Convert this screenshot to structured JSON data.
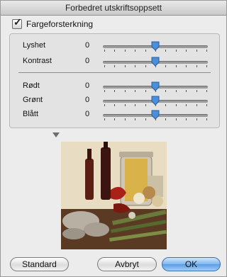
{
  "window": {
    "title": "Forbedret utskriftsoppsett"
  },
  "color_enhancement": {
    "label": "Fargeforsterkning",
    "checked": true
  },
  "sliders": [
    {
      "label": "Lyshet",
      "value": "0",
      "level": 0.5
    },
    {
      "label": "Kontrast",
      "value": "0",
      "level": 0.5
    },
    {
      "label": "Rødt",
      "value": "0",
      "level": 0.5
    },
    {
      "label": "Grønt",
      "value": "0",
      "level": 0.5
    },
    {
      "label": "Blått",
      "value": "0",
      "level": 0.5
    }
  ],
  "buttons": {
    "standard": "Standard",
    "cancel": "Avbryt",
    "ok": "OK"
  },
  "colors": {
    "ok_accent": "#5a9de6",
    "thumb": "#4a8fd8"
  }
}
